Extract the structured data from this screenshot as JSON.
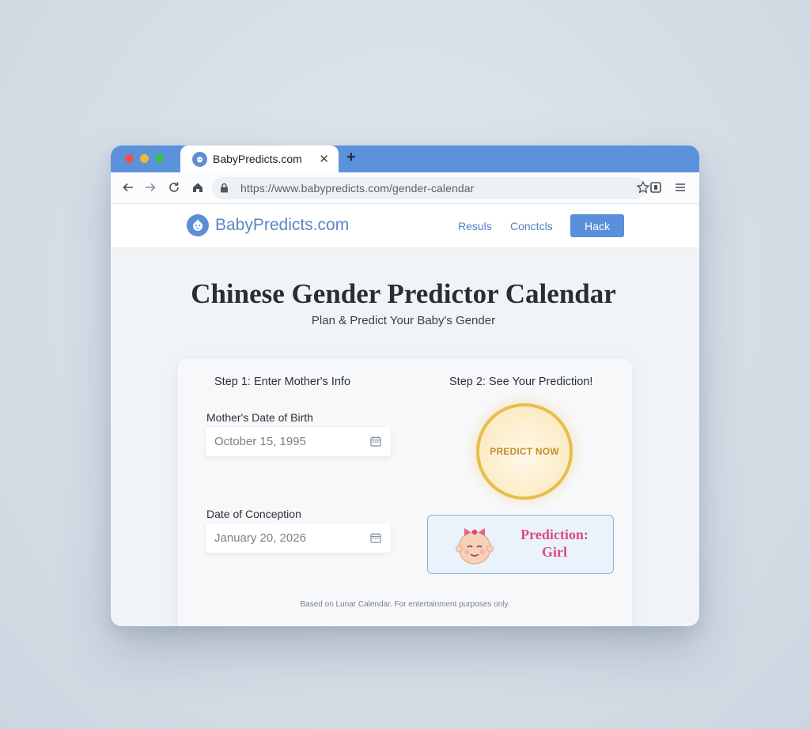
{
  "browser": {
    "tab_title": "BabyPredicts.com",
    "url": "https://www.babypredicts.com/gender-calendar"
  },
  "site": {
    "brand": "BabyPredicts.com",
    "nav": {
      "results": "Resuls",
      "contacts": "Conctcls",
      "button": "Hack"
    }
  },
  "main": {
    "title": "Chinese Gender Predictor Calendar",
    "subtitle": "Plan & Predict Your Baby's Gender",
    "step1": "Step 1: Enter Mother's Info",
    "step2": "Step 2: See Your Prediction!",
    "mother_dob_label": "Mother's Date of Birth",
    "mother_dob_value": "October 15, 1995",
    "conception_label": "Date of Conception",
    "conception_value": "January 20, 2026",
    "predict_button": "PREDICT NOW",
    "result_line1": "Prediction:",
    "result_line2": "Girl",
    "disclaimer": "Based on Lunar Calendar. For entertainment purposes only."
  },
  "colors": {
    "tab_bar": "#5c92dc",
    "accent": "#5a8fdc",
    "gold": "#e9bd4c",
    "girl_pink": "#d84e7c"
  }
}
